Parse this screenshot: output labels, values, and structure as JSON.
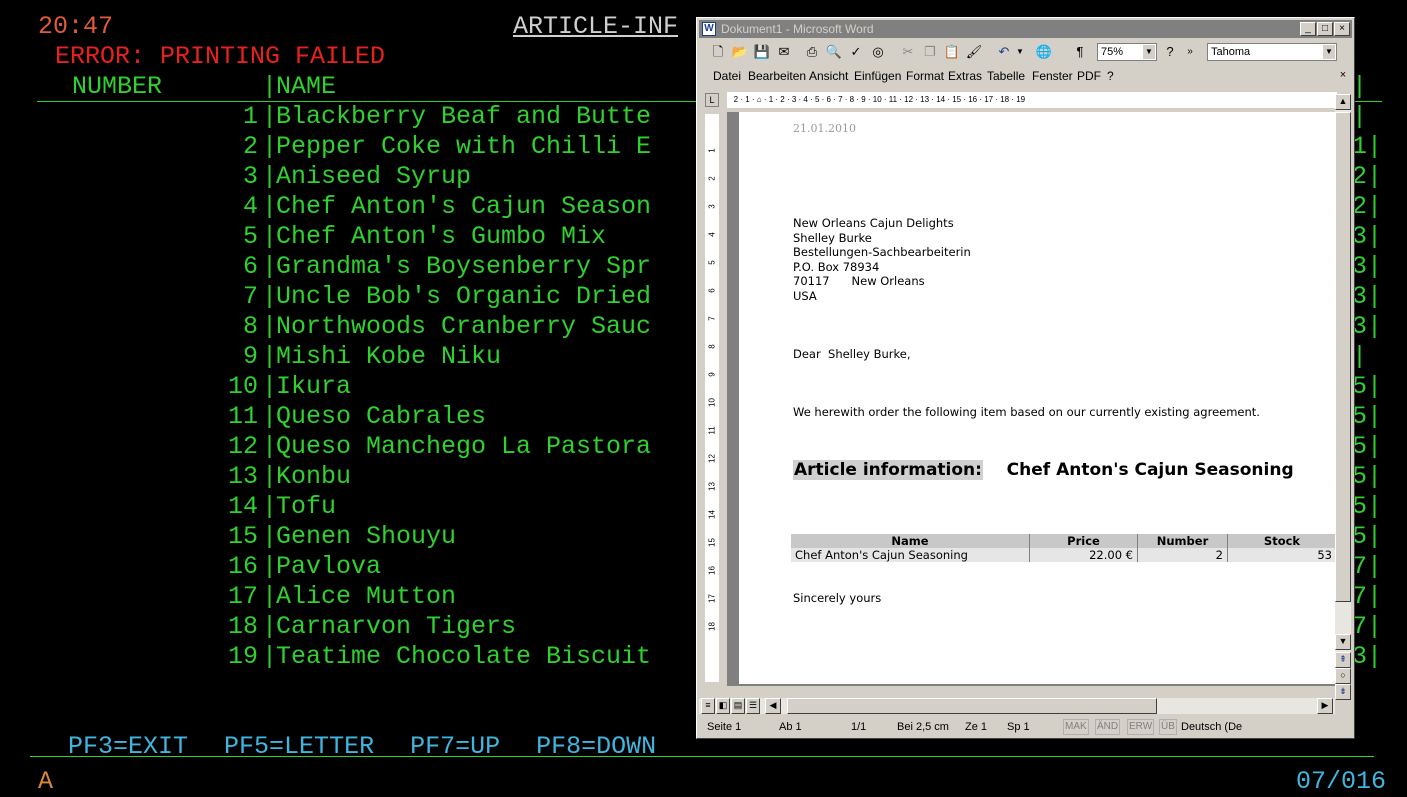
{
  "terminal": {
    "clock": "20:47",
    "title": "ARTICLE-INF",
    "error": "ERROR: PRINTING FAILED",
    "header_number": "NUMBER",
    "header_bar": "|",
    "header_name": "NAME",
    "rows": [
      {
        "num": "1",
        "name": "Blackberry Beaf and Butte"
      },
      {
        "num": "2",
        "name": "Pepper Coke with Chilli E"
      },
      {
        "num": "3",
        "name": "Aniseed Syrup"
      },
      {
        "num": "4",
        "name": "Chef Anton's Cajun Season"
      },
      {
        "num": "5",
        "name": "Chef Anton's Gumbo Mix"
      },
      {
        "num": "6",
        "name": "Grandma's Boysenberry Spr"
      },
      {
        "num": "7",
        "name": "Uncle Bob's Organic Dried"
      },
      {
        "num": "8",
        "name": "Northwoods Cranberry Sauc"
      },
      {
        "num": "9",
        "name": "Mishi Kobe Niku"
      },
      {
        "num": "10",
        "name": "Ikura"
      },
      {
        "num": "11",
        "name": "Queso Cabrales"
      },
      {
        "num": "12",
        "name": "Queso Manchego La Pastora"
      },
      {
        "num": "13",
        "name": "Konbu"
      },
      {
        "num": "14",
        "name": "Tofu"
      },
      {
        "num": "15",
        "name": "Genen Shouyu"
      },
      {
        "num": "16",
        "name": "Pavlova"
      },
      {
        "num": "17",
        "name": "Alice Mutton"
      },
      {
        "num": "18",
        "name": "Carnarvon Tigers"
      },
      {
        "num": "19",
        "name": "Teatime Chocolate Biscuit"
      }
    ],
    "right_col": [
      "|",
      "|",
      "1|",
      "2|",
      "2|",
      "3|",
      "3|",
      "3|",
      "3|",
      "|",
      "5|",
      "5|",
      "5|",
      "5|",
      "5|",
      "5|",
      "7|",
      "7|",
      "7|",
      "3|"
    ],
    "pf_keys": [
      "PF3=EXIT",
      "PF5=LETTER",
      "PF7=UP",
      "PF8=DOWN"
    ],
    "mode": "A",
    "position": "07/016"
  },
  "word": {
    "title": "Dokument1 - Microsoft Word",
    "zoom": "75%",
    "font": "Tahoma",
    "menu": [
      "Datei",
      "Bearbeiten",
      "Ansicht",
      "Einfügen",
      "Format",
      "Extras",
      "Tabelle",
      "Fenster",
      "PDF",
      "?"
    ],
    "document": {
      "date": "21.01.2010",
      "address": [
        "New Orleans Cajun Delights",
        "Shelley Burke",
        "Bestellungen-Sachbearbeiterin",
        "P.O. Box 78934",
        "70117      New Orleans",
        "USA"
      ],
      "salutation": "Dear  Shelley Burke,",
      "body": "We herewith order the following item based on our currently existing agreement.",
      "heading_label": "Article information:",
      "heading_value": "Chef Anton's Cajun Seasoning",
      "table_headers": [
        "Name",
        "Price",
        "Number",
        "Stock"
      ],
      "table_row": [
        "Chef Anton's Cajun Seasoning",
        "22.00 €",
        "2",
        "53"
      ],
      "closing": "Sincerely yours"
    },
    "status": {
      "page": "Seite  1",
      "section": "Ab  1",
      "pages": "1/1",
      "at": "Bei  2,5 cm",
      "line": "Ze  1",
      "col": "Sp  1",
      "mak": "MAK",
      "and": "ÄND",
      "erw": "ERW",
      "ub": "ÜB",
      "lang": "Deutsch (De"
    }
  }
}
